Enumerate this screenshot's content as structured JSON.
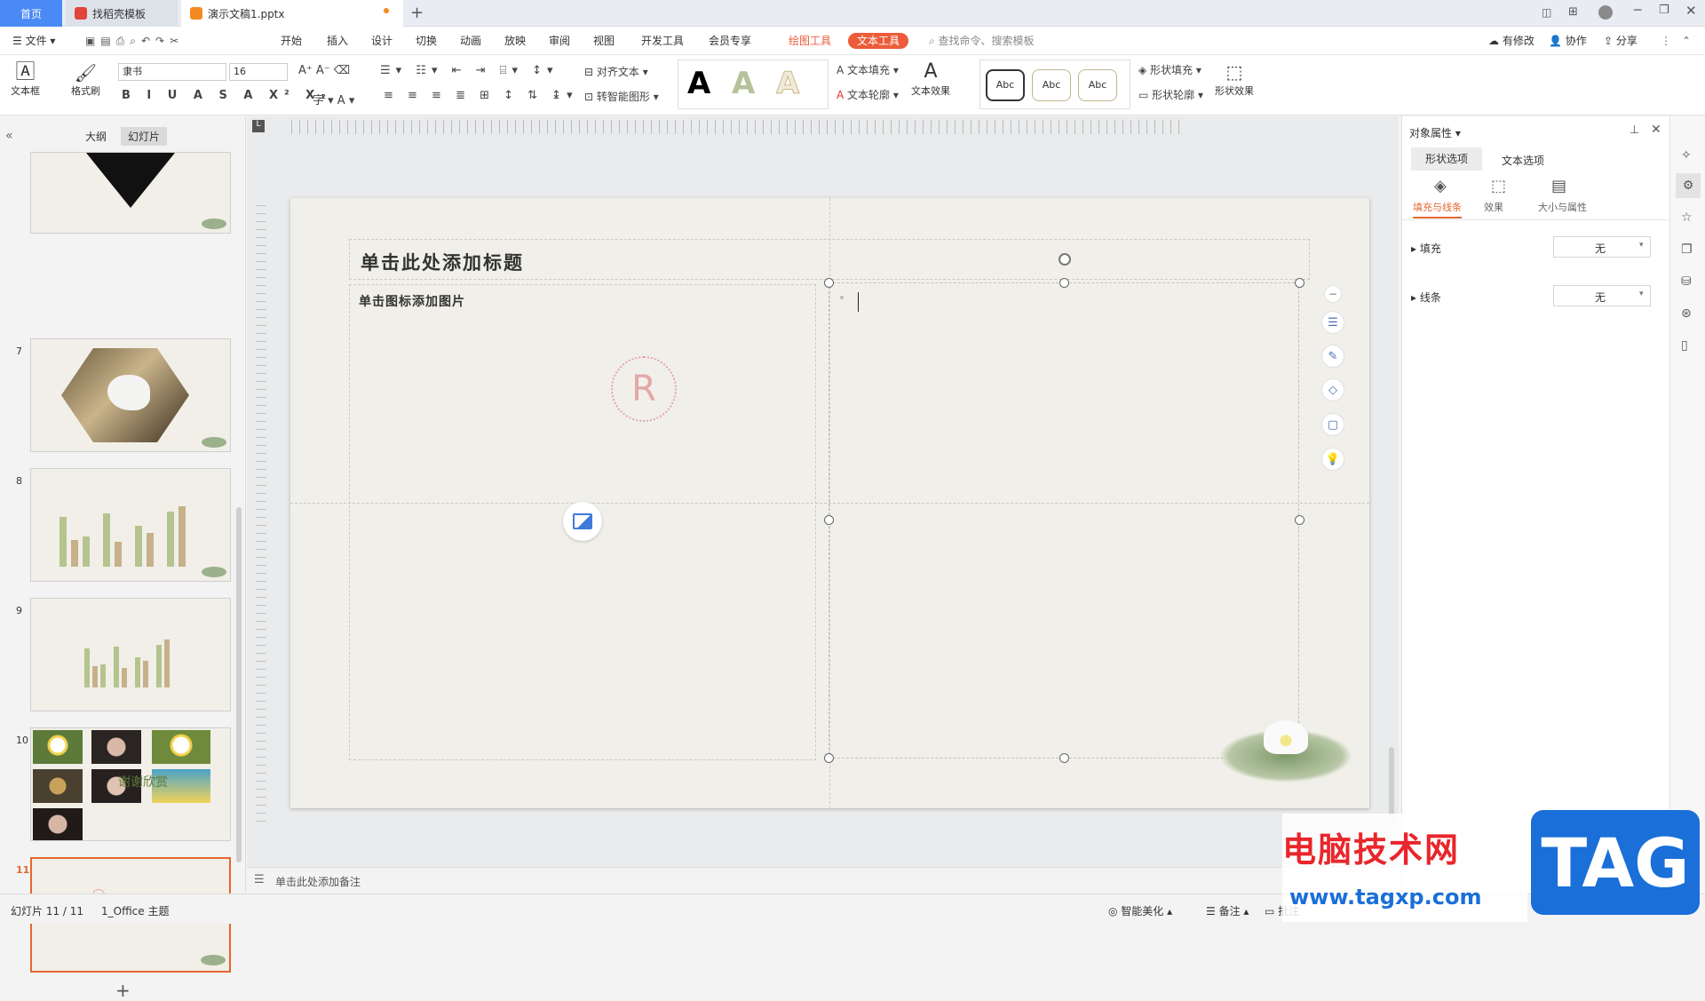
{
  "tabs": {
    "home": "首页",
    "template": "找稻壳模板",
    "doc": "演示文稿1.pptx"
  },
  "menubar": {
    "file": "文件",
    "items": [
      "开始",
      "插入",
      "设计",
      "切换",
      "动画",
      "放映",
      "审阅",
      "视图",
      "开发工具",
      "会员专享"
    ],
    "drawing_tools": "绘图工具",
    "text_tools": "文本工具",
    "search": "查找命令、搜索模板",
    "modified": "有修改",
    "collab": "协作",
    "share": "分享"
  },
  "ribbon": {
    "textbox": "文本框",
    "format_painter": "格式刷",
    "font": "隶书",
    "size": "16",
    "align_text": "对齐文本",
    "smart_shape": "转智能图形",
    "text_fill": "文本填充",
    "text_outline": "文本轮廓",
    "text_effect": "文本效果",
    "abc": "Abc",
    "shape_fill": "形状填充",
    "shape_outline": "形状轮廓",
    "shape_effect": "形状效果"
  },
  "leftpanel": {
    "tab_outline": "大纲",
    "tab_slides": "幻灯片",
    "nums": [
      "7",
      "8",
      "9",
      "10",
      "11"
    ],
    "thumb10_text": "谢谢欣赏"
  },
  "slide": {
    "title_placeholder": "单击此处添加标题",
    "picture_placeholder": "单击图标添加图片",
    "logo_letter": "R"
  },
  "notes": "单击此处添加备注",
  "rightpanel": {
    "title": "对象属性",
    "tab_shape": "形状选项",
    "tab_text": "文本选项",
    "sub_fill_line": "填充与线条",
    "sub_effect": "效果",
    "sub_size": "大小与属性",
    "fill_label": "填充",
    "fill_value": "无",
    "line_label": "线条",
    "line_value": "无"
  },
  "status": {
    "slide_count": "幻灯片 11 / 11",
    "theme": "1_Office 主题",
    "beautify": "智能美化",
    "notes": "备注",
    "comments": "批注"
  },
  "watermark": {
    "cn": "电脑技术网",
    "url": "www.tagxp.com",
    "tag": "TAG"
  },
  "colors": {
    "accent": "#ec5c3a",
    "blue": "#4a8af4",
    "tag_blue": "#1a6fd8",
    "wm_red": "#e8262b"
  }
}
